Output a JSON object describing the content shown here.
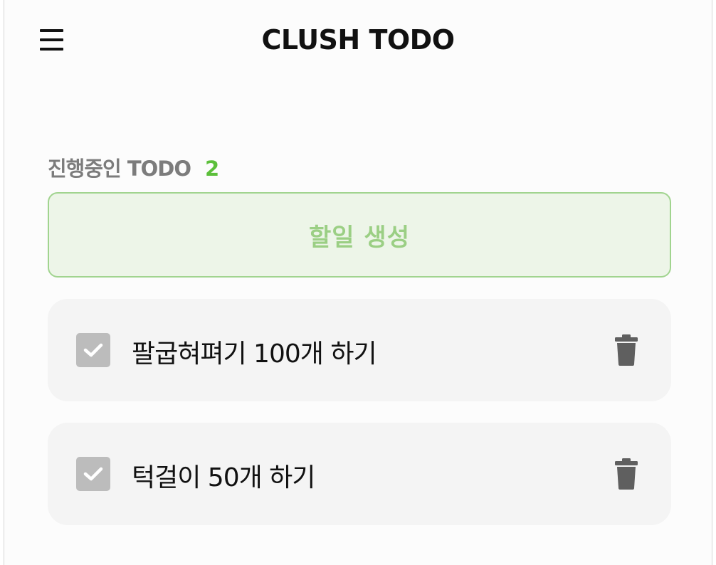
{
  "header": {
    "title": "CLUSH TODO",
    "menu_icon": "hamburger-menu-icon"
  },
  "section": {
    "label": "진행중인 TODO",
    "count": "2"
  },
  "create_button": {
    "label": "할일 생성"
  },
  "todos": [
    {
      "text": "팔굽혀펴기 100개 하기",
      "checked": true
    },
    {
      "text": "턱걸이 50개 하기",
      "checked": true
    }
  ],
  "colors": {
    "accent_green": "#5cbf3b",
    "create_bg": "#edf5e8",
    "create_border": "#a1d48f",
    "create_text": "#9bcf84",
    "item_bg": "#f4f4f4",
    "checkbox_bg": "#bcbcbc",
    "trash_icon": "#5f5f5f"
  }
}
